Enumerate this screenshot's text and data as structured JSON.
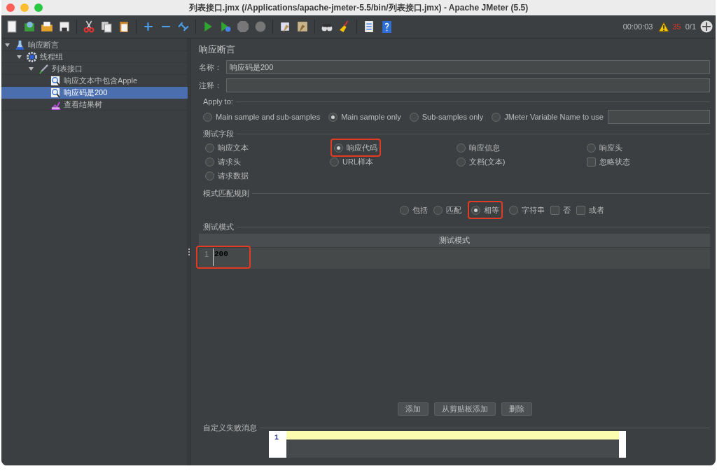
{
  "window": {
    "title": "列表接口.jmx (/Applications/apache-jmeter-5.5/bin/列表接口.jmx) - Apache JMeter (5.5)"
  },
  "toolbar": {
    "elapsed": "00:00:03",
    "warning_count": "35",
    "threads": "0/1"
  },
  "tree": [
    {
      "label": "响应断言",
      "kind": "assertion",
      "selected": false,
      "expanded": true,
      "children": [
        {
          "label": "线程组",
          "kind": "thread-group",
          "selected": false,
          "expanded": true,
          "children": [
            {
              "label": "列表接口",
              "kind": "sampler",
              "selected": false,
              "expanded": true,
              "children": [
                {
                  "label": "响应文本中包含Apple",
                  "kind": "assertion-item",
                  "selected": false
                },
                {
                  "label": "响应码是200",
                  "kind": "assertion-item",
                  "selected": true
                },
                {
                  "label": "查看结果树",
                  "kind": "listener",
                  "selected": false
                }
              ]
            }
          ]
        }
      ]
    }
  ],
  "panel": {
    "title": "响应断言",
    "name_label": "名称：",
    "name_value": "响应码是200",
    "comment_label": "注释：",
    "apply_to": {
      "title": "Apply to:",
      "options": [
        {
          "label": "Main sample and sub-samples",
          "selected": false
        },
        {
          "label": "Main sample only",
          "selected": true
        },
        {
          "label": "Sub-samples only",
          "selected": false
        },
        {
          "label": "JMeter Variable Name to use",
          "selected": false
        }
      ]
    },
    "test_field": {
      "title": "测试字段",
      "options": [
        {
          "label": "响应文本",
          "kind": "radio",
          "selected": false,
          "highlighted": false
        },
        {
          "label": "响应代码",
          "kind": "radio",
          "selected": true,
          "highlighted": true
        },
        {
          "label": "响应信息",
          "kind": "radio",
          "selected": false,
          "highlighted": false
        },
        {
          "label": "响应头",
          "kind": "radio",
          "selected": false,
          "highlighted": false
        },
        {
          "label": "请求头",
          "kind": "radio",
          "selected": false,
          "highlighted": false
        },
        {
          "label": "URL样本",
          "kind": "radio",
          "selected": false,
          "highlighted": false
        },
        {
          "label": "文档(文本)",
          "kind": "radio",
          "selected": false,
          "highlighted": false
        },
        {
          "label": "忽略状态",
          "kind": "checkbox",
          "selected": false,
          "highlighted": false
        },
        {
          "label": "请求数据",
          "kind": "radio",
          "selected": false,
          "highlighted": false
        }
      ]
    },
    "match_rules": {
      "title": "模式匹配规则",
      "options": [
        {
          "label": "包括",
          "kind": "radio",
          "selected": false,
          "highlighted": false
        },
        {
          "label": "匹配",
          "kind": "radio",
          "selected": false,
          "highlighted": false
        },
        {
          "label": "相等",
          "kind": "radio",
          "selected": true,
          "highlighted": true
        },
        {
          "label": "字符串",
          "kind": "radio",
          "selected": false,
          "highlighted": false
        },
        {
          "label": "否",
          "kind": "checkbox",
          "selected": false,
          "highlighted": false
        },
        {
          "label": "或者",
          "kind": "checkbox",
          "selected": false,
          "highlighted": false
        }
      ]
    },
    "patterns": {
      "title": "测试模式",
      "column": "测试模式",
      "rows": [
        {
          "line": "1",
          "value": "200",
          "highlighted": true
        }
      ]
    },
    "buttons": [
      "添加",
      "从剪贴板添加",
      "删除"
    ],
    "custom_message": {
      "title": "自定义失败消息",
      "line": "1"
    }
  }
}
